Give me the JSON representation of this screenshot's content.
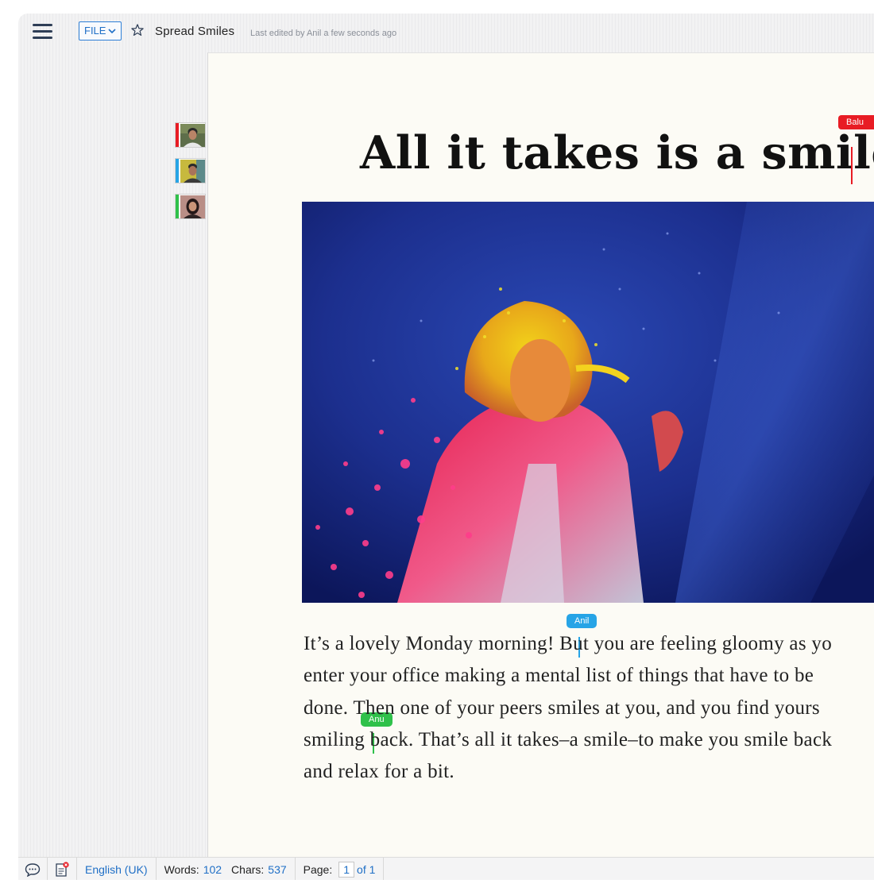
{
  "toolbar": {
    "file_label": "FILE",
    "doc_title": "Spread Smiles",
    "last_edited": "Last edited by Anil a few seconds ago"
  },
  "collaborators": [
    {
      "name": "Balu",
      "color": "#e81c24"
    },
    {
      "name": "Anil",
      "color": "#27a4e6"
    },
    {
      "name": "Anu",
      "color": "#2fc14a"
    }
  ],
  "document": {
    "heading": "All it takes is a smile",
    "paragraph_lines": [
      "It’s a lovely Monday morning! But you are feeling gloomy as yo",
      "enter your office making a mental list of things that have to be",
      "done. Then one of your peers smiles at you, and you find yours",
      "smiling back. That’s all it takes–a smile–to make you smile back",
      "and relax for a bit."
    ]
  },
  "status": {
    "language": "English (UK)",
    "words_label": "Words:",
    "words_value": "102",
    "chars_label": "Chars:",
    "chars_value": "537",
    "page_label": "Page:",
    "page_current": "1",
    "page_total": "of 1"
  }
}
